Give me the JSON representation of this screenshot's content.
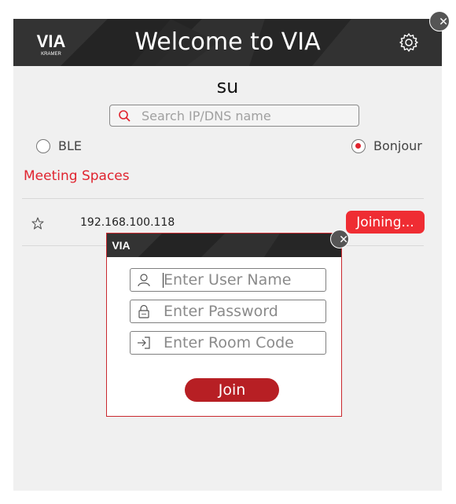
{
  "header": {
    "title": "Welcome to VIA",
    "logo_text": "VIA",
    "logo_subtext": "KRAMER",
    "settings_icon": "gear-icon",
    "close_icon": "close-icon"
  },
  "device_name": "su",
  "search": {
    "placeholder": "Search IP/DNS name",
    "value": "",
    "icon": "search-icon"
  },
  "discovery": {
    "options": [
      {
        "label": "BLE",
        "selected": false
      },
      {
        "label": "Bonjour",
        "selected": true
      }
    ]
  },
  "meeting_spaces": {
    "heading": "Meeting Spaces",
    "rows": [
      {
        "address": "192.168.100.118",
        "favorite_icon": "star-outline-icon",
        "status_button": "Joining..."
      }
    ]
  },
  "login_dialog": {
    "logo_text": "VIA",
    "fields": [
      {
        "placeholder": "Enter User Name",
        "value": "",
        "icon": "user-icon"
      },
      {
        "placeholder": "Enter Password",
        "value": "",
        "icon": "lock-icon"
      },
      {
        "placeholder": "Enter Room Code",
        "value": "",
        "icon": "enter-icon"
      }
    ],
    "join_label": "Join"
  },
  "colors": {
    "accent_red": "#ef2d33",
    "join_red": "#b71f24",
    "titlebar": "#2b2b2b",
    "background": "#f0f0f0"
  }
}
